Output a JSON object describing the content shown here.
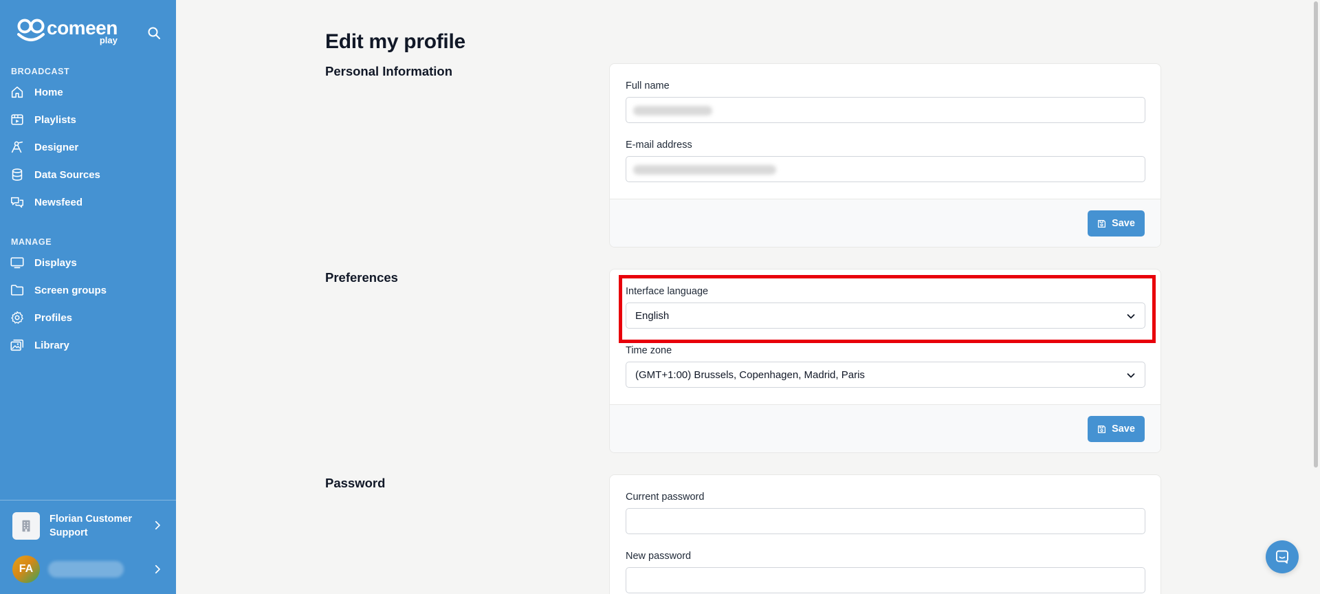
{
  "brand": {
    "name": "comeen",
    "sub": "play"
  },
  "sidebar": {
    "sections": [
      {
        "title": "BROADCAST",
        "items": [
          {
            "label": "Home",
            "icon": "home-icon"
          },
          {
            "label": "Playlists",
            "icon": "playlist-icon"
          },
          {
            "label": "Designer",
            "icon": "designer-icon"
          },
          {
            "label": "Data Sources",
            "icon": "database-icon"
          },
          {
            "label": "Newsfeed",
            "icon": "chat-bubbles-icon"
          }
        ]
      },
      {
        "title": "MANAGE",
        "items": [
          {
            "label": "Displays",
            "icon": "monitor-icon"
          },
          {
            "label": "Screen groups",
            "icon": "folder-icon"
          },
          {
            "label": "Profiles",
            "icon": "gear-icon"
          },
          {
            "label": "Library",
            "icon": "images-icon"
          }
        ]
      }
    ],
    "organization": "Florian Customer Support",
    "user_initials": "FA"
  },
  "page": {
    "title": "Edit my profile"
  },
  "personal": {
    "title": "Personal Information",
    "full_name_label": "Full name",
    "email_label": "E-mail address",
    "save_label": "Save"
  },
  "preferences": {
    "title": "Preferences",
    "language_label": "Interface language",
    "language_value": "English",
    "timezone_label": "Time zone",
    "timezone_value": "(GMT+1:00) Brussels, Copenhagen, Madrid, Paris",
    "save_label": "Save"
  },
  "password": {
    "title": "Password",
    "current_label": "Current password",
    "new_label": "New password"
  },
  "colors": {
    "sidebar": "#4592d2",
    "primary_button": "#4592d2",
    "highlight": "#e8000b",
    "background": "#f5f5f4"
  }
}
